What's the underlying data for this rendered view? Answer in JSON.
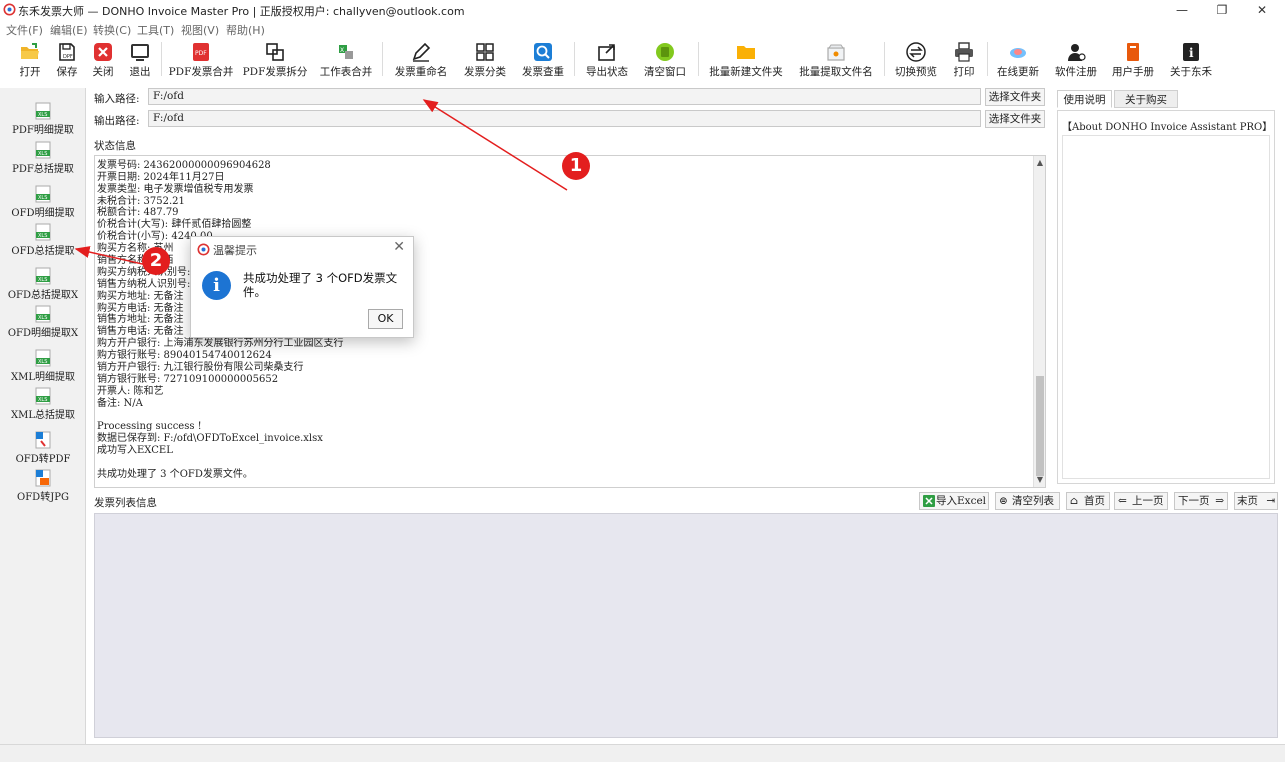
{
  "window": {
    "title": "东禾发票大师 — DONHO Invoice Master Pro  |  正版授权用户: challyven@outlook.com",
    "minimize_glyph": "—",
    "restore_glyph": "❐",
    "close_glyph": "✕"
  },
  "menu": [
    "文件(F)",
    "编辑(E)",
    "转换(C)",
    "工具(T)",
    "视图(V)",
    "帮助(H)"
  ],
  "toolbar": [
    {
      "label": "打开",
      "icon": "folder-open-icon"
    },
    {
      "label": "保存",
      "icon": "save-icon"
    },
    {
      "label": "关闭",
      "icon": "close-red-icon"
    },
    {
      "label": "退出",
      "icon": "exit-icon"
    },
    {
      "label": "PDF发票合并",
      "icon": "pdf-merge-icon"
    },
    {
      "label": "PDF发票拆分",
      "icon": "pdf-split-icon"
    },
    {
      "label": "工作表合并",
      "icon": "sheet-merge-icon"
    },
    {
      "label": "发票重命名",
      "icon": "rename-icon"
    },
    {
      "label": "发票分类",
      "icon": "grid-icon"
    },
    {
      "label": "发票查重",
      "icon": "duplicate-search-icon"
    },
    {
      "label": "导出状态",
      "icon": "export-icon"
    },
    {
      "label": "清空窗口",
      "icon": "clear-icon"
    },
    {
      "label": "批量新建文件夹",
      "icon": "new-folder-icon"
    },
    {
      "label": "批量提取文件名",
      "icon": "extract-filename-icon"
    },
    {
      "label": "切换预览",
      "icon": "switch-icon"
    },
    {
      "label": "打印",
      "icon": "printer-icon"
    },
    {
      "label": "在线更新",
      "icon": "cloud-update-icon"
    },
    {
      "label": "软件注册",
      "icon": "user-register-icon"
    },
    {
      "label": "用户手册",
      "icon": "book-icon"
    },
    {
      "label": "关于东禾",
      "icon": "info-icon"
    }
  ],
  "sidebar": [
    {
      "label": "PDF明细提取",
      "icon": "xls-icon"
    },
    {
      "label": "PDF总括提取",
      "icon": "xls-icon"
    },
    {
      "label": "OFD明细提取",
      "icon": "xls-icon"
    },
    {
      "label": "OFD总括提取",
      "icon": "xls-icon"
    },
    {
      "label": "OFD总括提取X",
      "icon": "xls-icon"
    },
    {
      "label": "OFD明细提取X",
      "icon": "xls-icon"
    },
    {
      "label": "XML明细提取",
      "icon": "xls-icon"
    },
    {
      "label": "XML总括提取",
      "icon": "xls-icon"
    },
    {
      "label": "OFD转PDF",
      "icon": "pdf-file-icon"
    },
    {
      "label": "OFD转JPG",
      "icon": "jpg-file-icon"
    }
  ],
  "paths": {
    "input_label": "输入路径:",
    "input_value": "F:/ofd",
    "output_label": "输出路径:",
    "output_value": "F:/ofd",
    "choose_folder": "选择文件夹"
  },
  "status": {
    "label": "状态信息",
    "lines": [
      "",
      "发票号码: 24362000000096904628",
      "开票日期: 2024年11月27日",
      "发票类型: 电子发票增值税专用发票",
      "未税合计: 3752.21",
      "税额合计: 487.79",
      "价税合计(大写): 肆仟贰佰肆拾圆整",
      "价税合计(小写): 4240.00",
      "购买方名称: 苏州",
      "销售方名称: 江西",
      "购买方纳税人识别号:",
      "销售方纳税人识别号:",
      "购买方地址: 无备注",
      "购买方电话: 无备注",
      "销售方地址: 无备注",
      "销售方电话: 无备注",
      "购方开户银行: 上海浦东发展银行苏州分行工业园区支行",
      "购方银行账号: 89040154740012624",
      "销方开户银行: 九江银行股份有限公司柴桑支行",
      "销方银行账号: 727109100000005652",
      "开票人: 陈和艺",
      "备注: N/A",
      "",
      "Processing success !",
      "数据已保存到: F:/ofd\\OFDToExcel_invoice.xlsx",
      "成功写入EXCEL",
      "",
      "共成功处理了 3 个OFD发票文件。"
    ]
  },
  "list": {
    "label": "发票列表信息",
    "import_excel": "导入Excel",
    "clear_list": "清空列表",
    "first_page": "首页",
    "prev_page": "上一页",
    "next_page": "下一页",
    "last_page": "末页"
  },
  "right_panel": {
    "tab_usage": "使用说明",
    "tab_buy": "关于购买",
    "help_text": "【About DONHO Invoice Assistant PRO】"
  },
  "dialog": {
    "title": "温馨提示",
    "message": "共成功处理了 3 个OFD发票文件。",
    "ok": "OK",
    "info_glyph": "i",
    "close_glyph": "✕"
  },
  "annotations": {
    "callout_1": "1",
    "callout_2": "2",
    "color": "#e31e1e"
  }
}
